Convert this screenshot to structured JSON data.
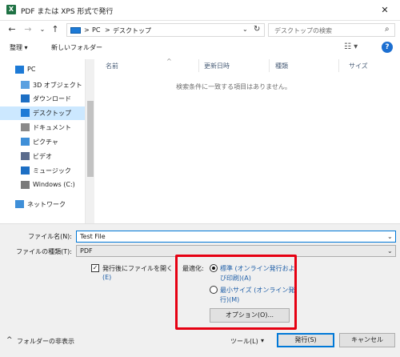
{
  "window": {
    "title": "PDF または XPS 形式で発行",
    "app_icon_letter": "X",
    "close_glyph": "✕"
  },
  "nav": {
    "back": "←",
    "forward": "→",
    "dropdown": "⌄",
    "up": "↑",
    "breadcrumb": [
      "PC",
      "デスクトップ"
    ],
    "breadcrumb_sep": ">",
    "refresh": "↻",
    "search_placeholder": "デスクトップの検索",
    "search_icon": "⌕"
  },
  "toolbar": {
    "organize": "整理 ▾",
    "new_folder": "新しいフォルダー",
    "view_icon": "☷ ▾",
    "help": "?"
  },
  "sidebar": {
    "items": [
      {
        "label": "PC",
        "icon": "pc-icon",
        "color": "#1d7ad6"
      },
      {
        "label": "3D オブジェクト",
        "icon": "3d-objects-icon",
        "color": "#5aa0e0"
      },
      {
        "label": "ダウンロード",
        "icon": "download-icon",
        "color": "#1d6fc4"
      },
      {
        "label": "デスクトップ",
        "icon": "desktop-icon",
        "color": "#1d7ad6"
      },
      {
        "label": "ドキュメント",
        "icon": "documents-icon",
        "color": "#8a8a8a"
      },
      {
        "label": "ピクチャ",
        "icon": "pictures-icon",
        "color": "#3f8fd8"
      },
      {
        "label": "ビデオ",
        "icon": "videos-icon",
        "color": "#5a6b8c"
      },
      {
        "label": "ミュージック",
        "icon": "music-icon",
        "color": "#1d6fc4"
      },
      {
        "label": "Windows (C:)",
        "icon": "drive-icon",
        "color": "#7a7a7a"
      },
      {
        "label": "ネットワーク",
        "icon": "network-icon",
        "color": "#3f8fd8"
      }
    ]
  },
  "filelist": {
    "columns": [
      "名前",
      "更新日時",
      "種類",
      "サイズ"
    ],
    "sort_caret": "^",
    "empty_message": "検索条件に一致する項目はありません。"
  },
  "form": {
    "filename_label": "ファイル名(N):",
    "filename_value": "Test File",
    "filetype_label": "ファイルの種類(T):",
    "filetype_value": "PDF",
    "dropdown_glyph": "⌄",
    "open_after_line1": "発行後にファイルを開く",
    "open_after_line2": "(E)",
    "checkbox_mark": "✓",
    "optimize_label": "最適化:",
    "standard_line1": "標準 (オンライン発行およ",
    "standard_line2": "び印刷)(A)",
    "minimum_line1": "最小サイズ (オンライン発",
    "minimum_line2": "行)(M)",
    "options_button": "オプション(O)..."
  },
  "footer": {
    "hide_folders": "フォルダーの非表示",
    "hide_glyph": "^",
    "tools": "ツール(L)",
    "tools_dd": "▾",
    "publish": "発行(S)",
    "cancel": "キャンセル"
  },
  "colors": {
    "accent": "#0078d7",
    "highlight_frame": "#e60012",
    "selection": "#cce8ff"
  }
}
